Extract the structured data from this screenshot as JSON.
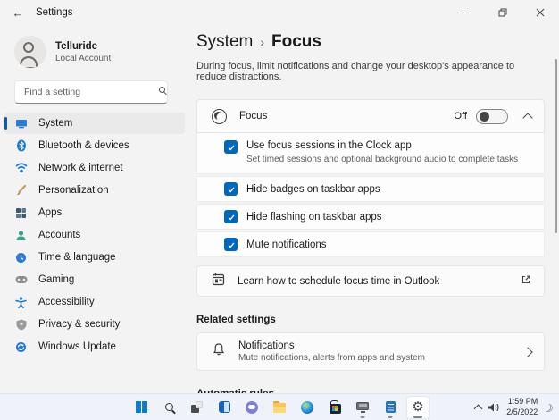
{
  "colors": {
    "accent": "#005fb8",
    "checkbox_blue": "#0067c0",
    "taskbar_bg": "#eff3f9",
    "card_bg": "#fbfbfb"
  },
  "titlebar": {
    "title": "Settings",
    "back_glyph": "←"
  },
  "sidebar": {
    "user": {
      "name": "Telluride",
      "account_type": "Local Account"
    },
    "search": {
      "placeholder": "Find a setting"
    },
    "items": [
      {
        "label": "System",
        "icon": "system-icon",
        "selected": true
      },
      {
        "label": "Bluetooth & devices",
        "icon": "bluetooth-icon"
      },
      {
        "label": "Network & internet",
        "icon": "network-icon"
      },
      {
        "label": "Personalization",
        "icon": "personalization-icon"
      },
      {
        "label": "Apps",
        "icon": "apps-icon"
      },
      {
        "label": "Accounts",
        "icon": "accounts-icon"
      },
      {
        "label": "Time & language",
        "icon": "time-language-icon"
      },
      {
        "label": "Gaming",
        "icon": "gaming-icon"
      },
      {
        "label": "Accessibility",
        "icon": "accessibility-icon"
      },
      {
        "label": "Privacy & security",
        "icon": "privacy-icon"
      },
      {
        "label": "Windows Update",
        "icon": "windows-update-icon"
      }
    ]
  },
  "main": {
    "breadcrumb": {
      "parent": "System",
      "separator": "›",
      "current": "Focus"
    },
    "description": "During focus, limit notifications and change your desktop's appearance to reduce distractions.",
    "focus": {
      "label": "Focus",
      "state": "Off"
    },
    "options": [
      {
        "label": "Use focus sessions in the Clock app",
        "description": "Set timed sessions and optional background audio to complete tasks",
        "checked": true
      },
      {
        "label": "Hide badges on taskbar apps",
        "checked": true
      },
      {
        "label": "Hide flashing on taskbar apps",
        "checked": true
      },
      {
        "label": "Mute notifications",
        "checked": true
      }
    ],
    "outlook": {
      "label": "Learn how to schedule focus time in Outlook"
    },
    "related_settings_heading": "Related settings",
    "notifications": {
      "title": "Notifications",
      "description": "Mute notifications, alerts from apps and system"
    },
    "automatic_rules_heading": "Automatic rules"
  },
  "taskbar": {
    "icons": [
      "start",
      "search",
      "task-view",
      "widgets",
      "chat",
      "file-explorer",
      "edge",
      "store",
      "display-app",
      "document-app",
      "settings"
    ],
    "tray": {
      "time": "1:59 PM",
      "date": "2/5/2022"
    }
  }
}
